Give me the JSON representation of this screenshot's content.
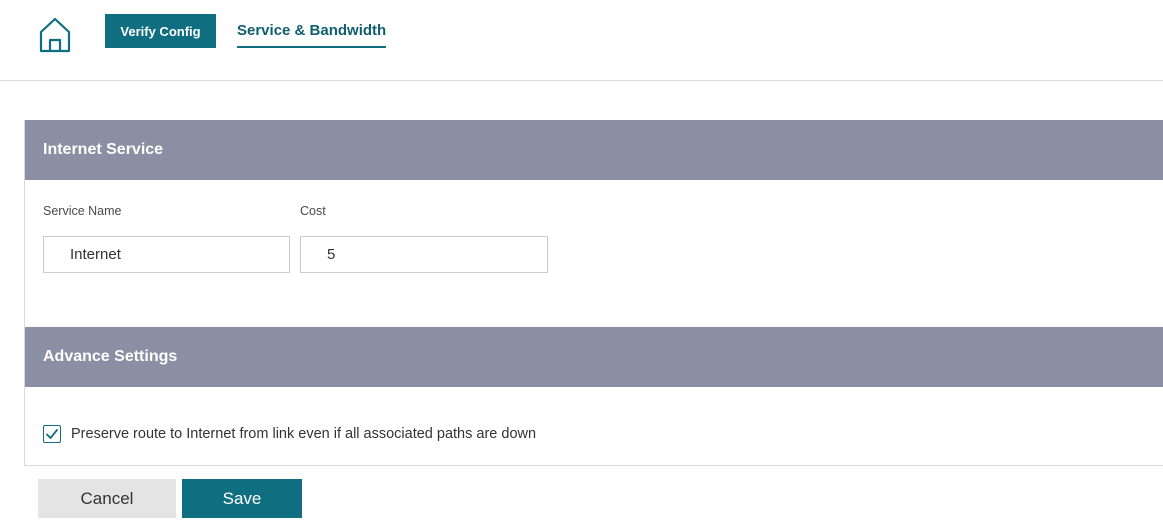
{
  "header": {
    "verify_button_label": "Verify Config",
    "active_tab_label": "Service & Bandwidth"
  },
  "internet_service": {
    "section_title": "Internet Service",
    "service_name_label": "Service Name",
    "service_name_value": "Internet",
    "cost_label": "Cost",
    "cost_value": "5"
  },
  "advance_settings": {
    "section_title": "Advance Settings",
    "preserve_route_label": "Preserve route to Internet from link even if all associated paths are down",
    "preserve_route_checked": true
  },
  "footer": {
    "cancel_label": "Cancel",
    "save_label": "Save"
  },
  "colors": {
    "accent": "#0f6e80",
    "section_header": "#8a8fa3",
    "cancel_bg": "#e4e4e4"
  },
  "icons": {
    "home": "home-icon",
    "check": "checkmark-icon"
  }
}
